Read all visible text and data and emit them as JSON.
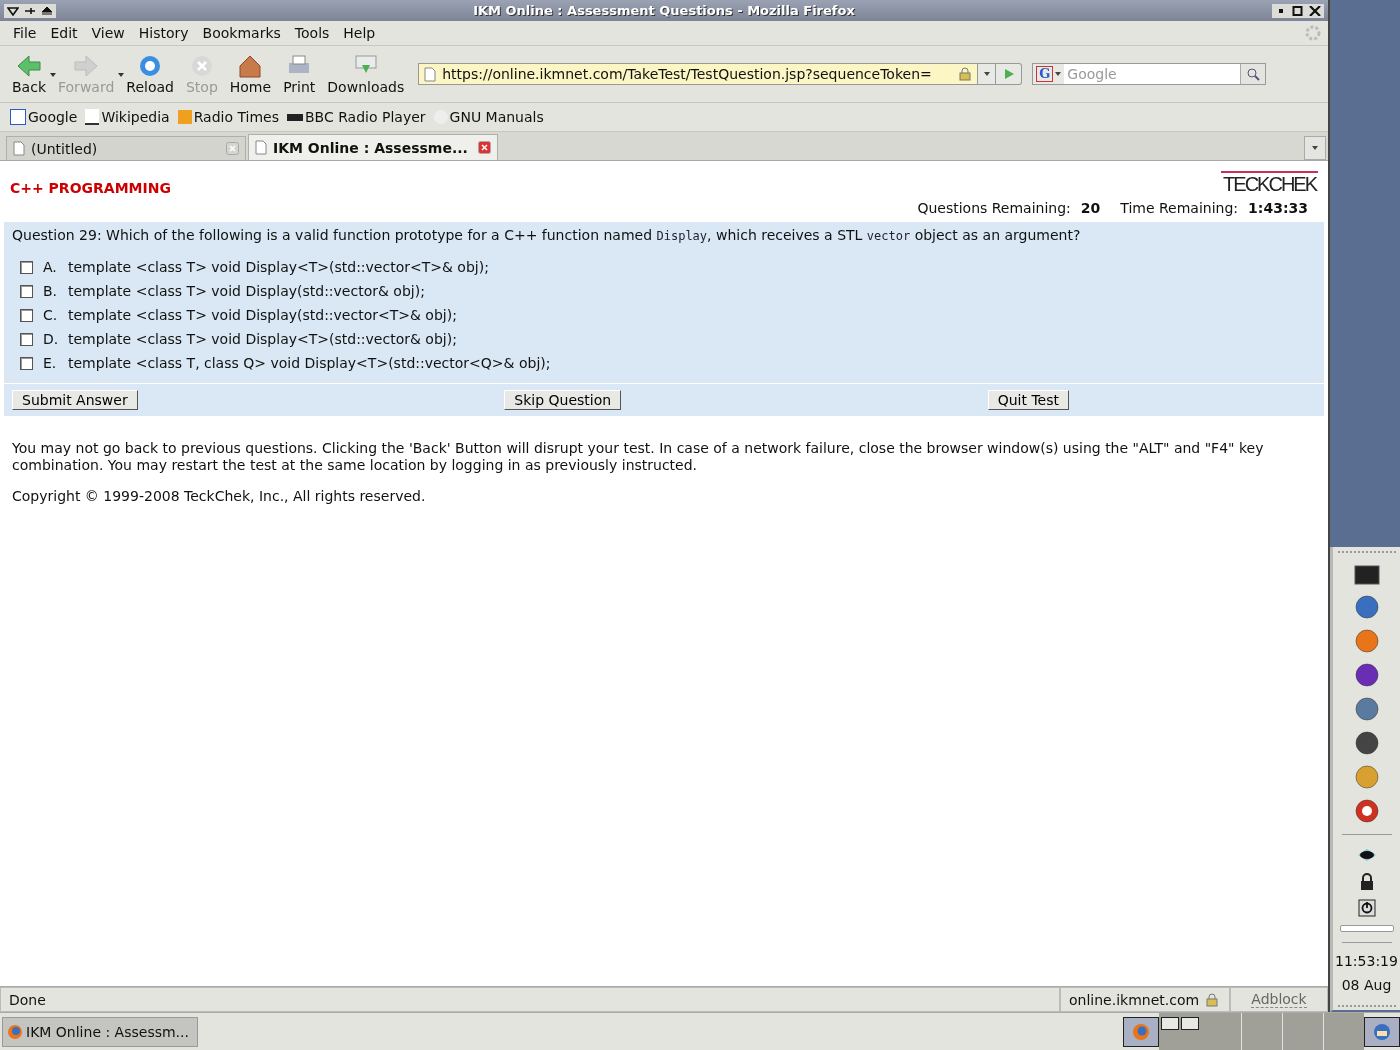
{
  "window": {
    "title": "IKM Online : Assessment Questions - Mozilla Firefox"
  },
  "menu": [
    "File",
    "Edit",
    "View",
    "History",
    "Bookmarks",
    "Tools",
    "Help"
  ],
  "toolbar": [
    {
      "label": "Back",
      "kind": "back",
      "disabled": false,
      "dropdown": true
    },
    {
      "label": "Forward",
      "kind": "forward",
      "disabled": true,
      "dropdown": true
    },
    {
      "label": "Reload",
      "kind": "reload",
      "disabled": false,
      "dropdown": false
    },
    {
      "label": "Stop",
      "kind": "stop",
      "disabled": true,
      "dropdown": false
    },
    {
      "label": "Home",
      "kind": "home",
      "disabled": false,
      "dropdown": false
    },
    {
      "label": "Print",
      "kind": "print",
      "disabled": false,
      "dropdown": false
    },
    {
      "label": "Downloads",
      "kind": "downloads",
      "disabled": false,
      "dropdown": false
    }
  ],
  "address": {
    "value": "https://online.ikmnet.com/TakeTest/TestQuestion.jsp?sequenceToken="
  },
  "search": {
    "engine": "G",
    "placeholder": "Google"
  },
  "bookmarks": [
    {
      "label": "Google",
      "kind": "g"
    },
    {
      "label": "Wikipedia",
      "kind": "w"
    },
    {
      "label": "Radio Times",
      "kind": "rt"
    },
    {
      "label": "BBC Radio Player",
      "kind": "bbc"
    },
    {
      "label": "GNU Manuals",
      "kind": "gnu"
    }
  ],
  "tabs": [
    {
      "label": "(Untitled)",
      "selected": false
    },
    {
      "label": "IKM Online : Assessme...",
      "selected": true
    }
  ],
  "page": {
    "subject": "C++ PROGRAMMING",
    "logo": "TECKCHEK",
    "questions_remaining_label": "Questions Remaining:",
    "questions_remaining": "20",
    "time_remaining_label": "Time Remaining:",
    "time_remaining": "1:43:33",
    "question": [
      {
        "kind": "text",
        "text": "Question 29: Which of the following is a valid function prototype for a C++ function named "
      },
      {
        "kind": "code",
        "text": "Display"
      },
      {
        "kind": "text",
        "text": ", which receives a STL "
      },
      {
        "kind": "code",
        "text": "vector"
      },
      {
        "kind": "text",
        "text": " object as an argument?"
      }
    ],
    "answers": [
      {
        "letter": "A.",
        "text": "template <class T> void Display<T>(std::vector<T>& obj);",
        "checked": false
      },
      {
        "letter": "B.",
        "text": "template <class T> void Display(std::vector& obj);",
        "checked": false
      },
      {
        "letter": "C.",
        "text": "template <class T> void Display(std::vector<T>& obj);",
        "checked": false
      },
      {
        "letter": "D.",
        "text": "template <class T> void Display<T>(std::vector& obj);",
        "checked": false
      },
      {
        "letter": "E.",
        "text": "template <class T, class Q> void Display<T>(std::vector<Q>& obj);",
        "checked": false
      }
    ],
    "buttons": [
      "Submit Answer",
      "Skip Question",
      "Quit Test"
    ],
    "notice": "You may not go back to previous questions. Clicking the 'Back' Button will disrupt your test. In case of a network failure, close the browser window(s) using the \"ALT\" and \"F4\" key combination. You may restart the test at the same location by logging in as previously instructed.",
    "copyright": "Copyright © 1999-2008 TeckChek, Inc., All rights reserved."
  },
  "status_bar": {
    "status": "Done",
    "host": "online.ikmnet.com",
    "adblock": "Adblock"
  },
  "panel": {
    "time": "11:53:19",
    "date": "08 Aug"
  },
  "taskbar": {
    "tasks": [
      {
        "label": "IKM Online : Assessm...",
        "selected": true
      }
    ]
  }
}
